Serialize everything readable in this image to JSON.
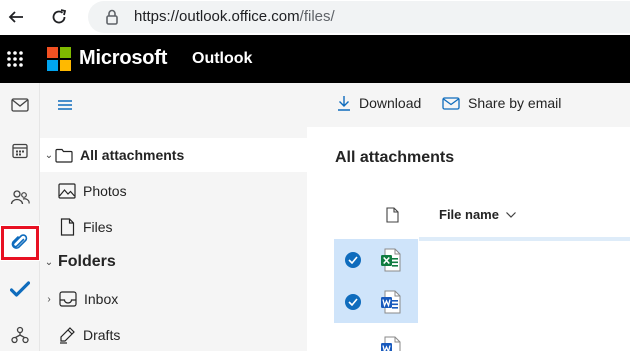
{
  "browser": {
    "url_host": "https://outlook.office.com",
    "url_path": "/files/"
  },
  "appbar": {
    "brand": "Microsoft",
    "app_name": "Outlook",
    "logo_colors": [
      "#f25022",
      "#7fba00",
      "#00a4ef",
      "#ffb900"
    ]
  },
  "rail": {
    "items": [
      {
        "icon": "mail-icon"
      },
      {
        "icon": "calendar-icon"
      },
      {
        "icon": "people-icon"
      },
      {
        "icon": "attachment-icon",
        "active": true
      },
      {
        "icon": "todo-check-icon"
      },
      {
        "icon": "org-explorer-icon"
      }
    ]
  },
  "folders": {
    "all_attachments": "All attachments",
    "photos": "Photos",
    "files": "Files",
    "section": "Folders",
    "inbox": "Inbox",
    "drafts": "Drafts"
  },
  "commands": {
    "download": "Download",
    "share": "Share by email"
  },
  "main": {
    "title": "All attachments",
    "col_file_name": "File name",
    "rows": [
      {
        "type": "excel",
        "selected": true
      },
      {
        "type": "word",
        "selected": true
      },
      {
        "type": "word",
        "selected": false
      }
    ]
  },
  "colors": {
    "accent": "#0f6cbd",
    "highlight": "#e81123",
    "excel": "#107c41",
    "word": "#185abd"
  }
}
